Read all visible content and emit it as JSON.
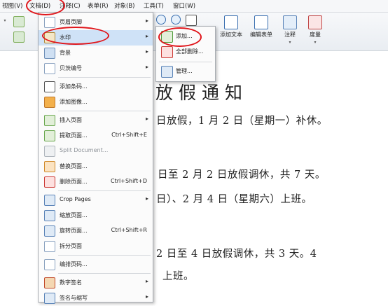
{
  "menubar": {
    "items": [
      "视图(V)",
      "文档(D)",
      "注释(C)",
      "表单(R)",
      "对象(B)",
      "工具(T)",
      "窗口(W)"
    ]
  },
  "toolbar": {
    "add_text": "添加文本",
    "edit_form": "编辑表单",
    "annotate": "注释",
    "measure": "度量"
  },
  "main_menu": {
    "items": [
      {
        "label": "页眉页脚",
        "icon": "header-footer-icon",
        "submenu": true
      },
      {
        "label": "水印",
        "icon": "watermark-icon",
        "submenu": true,
        "highlighted": true
      },
      {
        "label": "背景",
        "icon": "background-icon",
        "submenu": true
      },
      {
        "label": "贝茨编号",
        "icon": "bates-number-icon",
        "submenu": true
      },
      {
        "label": "添加条码...",
        "icon": "barcode-icon"
      },
      {
        "label": "添加图像...",
        "icon": "add-image-icon"
      },
      {
        "label": "插入页面",
        "icon": "insert-page-icon",
        "submenu": true
      },
      {
        "label": "提取页面...",
        "icon": "extract-page-icon",
        "shortcut": "Ctrl+Shift+E"
      },
      {
        "label": "Split Document...",
        "icon": "split-document-icon",
        "disabled": true
      },
      {
        "label": "替换页面...",
        "icon": "replace-page-icon"
      },
      {
        "label": "删除页面...",
        "icon": "delete-page-icon",
        "shortcut": "Ctrl+Shift+D"
      },
      {
        "label": "Crop Pages",
        "icon": "crop-pages-icon",
        "submenu": true
      },
      {
        "label": "缩放页面...",
        "icon": "resize-page-icon"
      },
      {
        "label": "旋转页面...",
        "icon": "rotate-page-icon",
        "shortcut": "Ctrl+Shift+R"
      },
      {
        "label": "拆分页面",
        "icon": "split-page-icon"
      },
      {
        "label": "编排页码...",
        "icon": "page-number-icon"
      },
      {
        "label": "数字签名",
        "icon": "digital-signature-icon",
        "submenu": true
      },
      {
        "label": "签名与缩写",
        "icon": "sign-initials-icon",
        "submenu": true
      }
    ]
  },
  "submenu": {
    "items": [
      {
        "label": "添加...",
        "icon": "add-watermark-icon"
      },
      {
        "label": "全部删除...",
        "icon": "delete-all-watermark-icon"
      },
      {
        "label": "管理...",
        "icon": "manage-watermark-icon"
      }
    ]
  },
  "document": {
    "title": "放假通知",
    "lines": [
      "日放假，1 月 2 日（星期一）补休。",
      "日至 2 月 2 日放假调休，共 7 天。",
      "日）、2 月 4 日（星期六）上班。",
      "2 日至 4 日放假调休，共 3 天。4",
      "上班。"
    ]
  },
  "colors": {
    "annotation_red": "#e0161b",
    "highlight": "#cfe2f7"
  }
}
